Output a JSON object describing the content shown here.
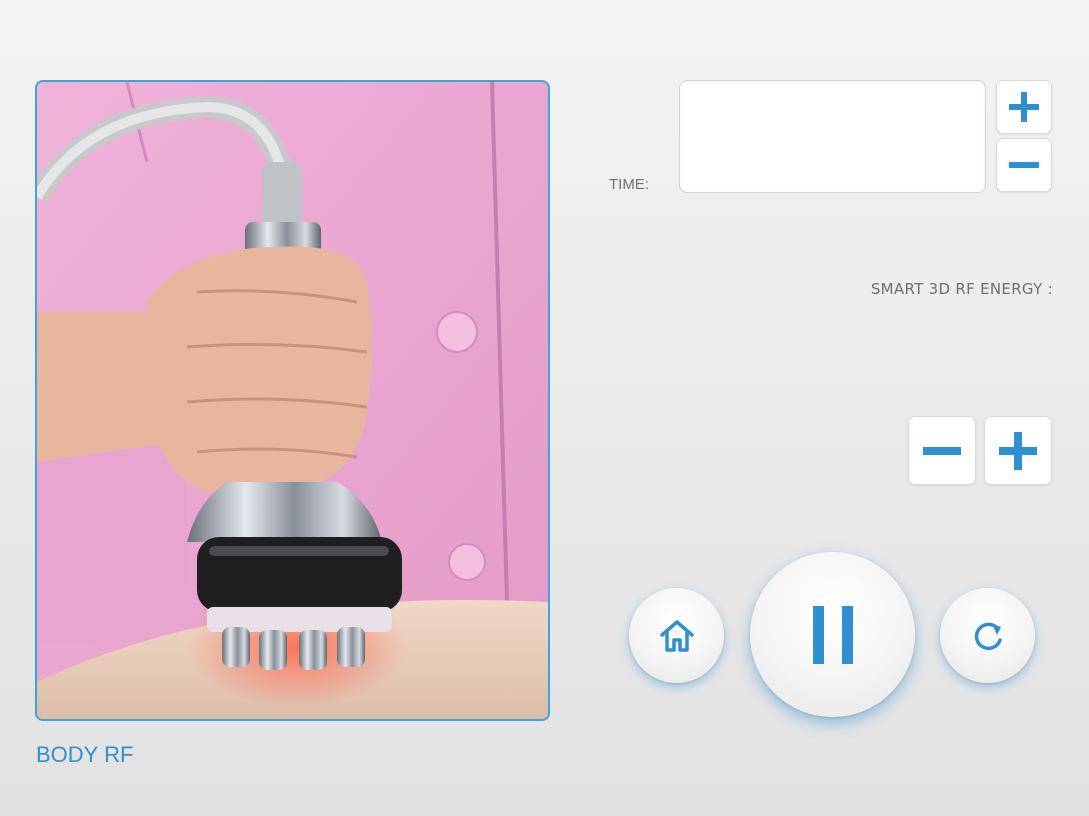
{
  "mode": {
    "label": "BODY RF"
  },
  "time": {
    "label": "TIME:",
    "value": ""
  },
  "energy": {
    "label": "SMART 3D RF ENERGY :",
    "value": ""
  },
  "icons": {
    "time_plus": "plus-icon",
    "time_minus": "minus-icon",
    "energy_minus": "minus-icon",
    "energy_plus": "plus-icon",
    "home": "home-icon",
    "pause": "pause-icon",
    "refresh": "refresh-icon"
  },
  "colors": {
    "accent": "#2f8fd0",
    "frame_border": "#3aa6dc",
    "label_gray": "#707070"
  }
}
